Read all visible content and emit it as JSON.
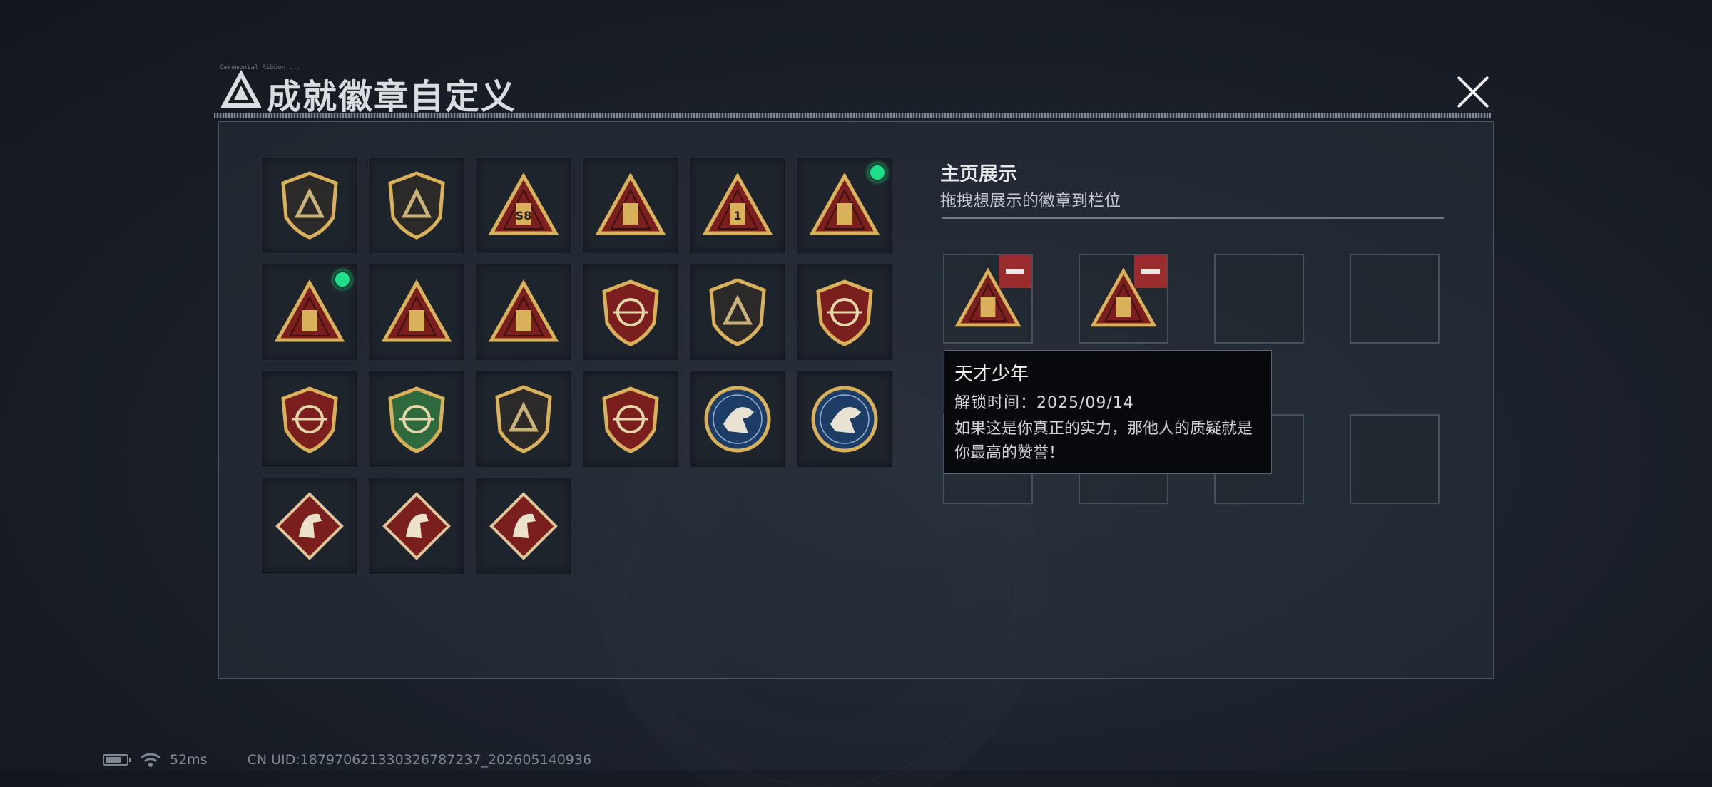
{
  "window": {
    "title": "成就徽章自定义",
    "title_tiny": "Ceremonial Ribbon ..."
  },
  "badges": [
    {
      "icon": "triangle-logo-shield-badge-icon",
      "equipped": false
    },
    {
      "icon": "helicopter-shield-badge-icon",
      "equipped": false
    },
    {
      "icon": "s8-triangle-badge-icon",
      "equipped": false,
      "text": "S8"
    },
    {
      "icon": "ship-triangle-badge-icon",
      "equipped": false
    },
    {
      "icon": "number-one-triangle-badge-icon",
      "equipped": false,
      "text": "1"
    },
    {
      "icon": "usb-triangle-badge-icon",
      "equipped": true
    },
    {
      "icon": "usb-skull-triangle-badge-icon",
      "equipped": true
    },
    {
      "icon": "soldiers-triangle-badge-icon",
      "equipped": false
    },
    {
      "icon": "rocket-triangle-badge-icon",
      "equipped": false
    },
    {
      "icon": "star-medal-badge-icon",
      "equipped": false
    },
    {
      "icon": "chevron-shield-badge-icon",
      "equipped": false
    },
    {
      "icon": "winged-shield-ribbon-badge-icon",
      "equipped": false
    },
    {
      "icon": "red-gem-crest-badge-icon",
      "equipped": false
    },
    {
      "icon": "green-rifle-crest-badge-icon",
      "equipped": false
    },
    {
      "icon": "bronze-rifle-shield-badge-icon",
      "equipped": false
    },
    {
      "icon": "crossed-weapons-crest-badge-icon",
      "equipped": false
    },
    {
      "icon": "eagle-round-badge-icon",
      "equipped": false
    },
    {
      "icon": "wolf-round-badge-icon",
      "equipped": false
    },
    {
      "icon": "horse-diamond-badge-icon",
      "equipped": false
    },
    {
      "icon": "horse-diamond-badge-2-icon",
      "equipped": false
    },
    {
      "icon": "tools-diamond-badge-icon",
      "equipped": false
    }
  ],
  "showcase": {
    "title": "主页展示",
    "subtitle": "拖拽想展示的徽章到栏位",
    "slots": [
      {
        "icon": "usb-triangle-badge-icon",
        "filled": true
      },
      {
        "icon": "usb-skull-triangle-badge-icon",
        "filled": true
      },
      {
        "filled": false
      },
      {
        "filled": false
      },
      {
        "filled": false
      },
      {
        "filled": false
      },
      {
        "filled": false
      },
      {
        "filled": false
      }
    ]
  },
  "tooltip": {
    "title": "天才少年",
    "unlock": "解锁时间：2025/09/14",
    "description": "如果这是你真正的实力，那他人的质疑就是你最高的赞誉！"
  },
  "status": {
    "battery_level": 0.75,
    "ping": "52ms",
    "uid": "CN UID:18797062133032678723​7_202605140936"
  },
  "colors": {
    "accent_green": "#1ee08a",
    "remove_red": "#9a2b2f",
    "gold": "#d9b15a",
    "badge_red": "#7a1e1e"
  }
}
